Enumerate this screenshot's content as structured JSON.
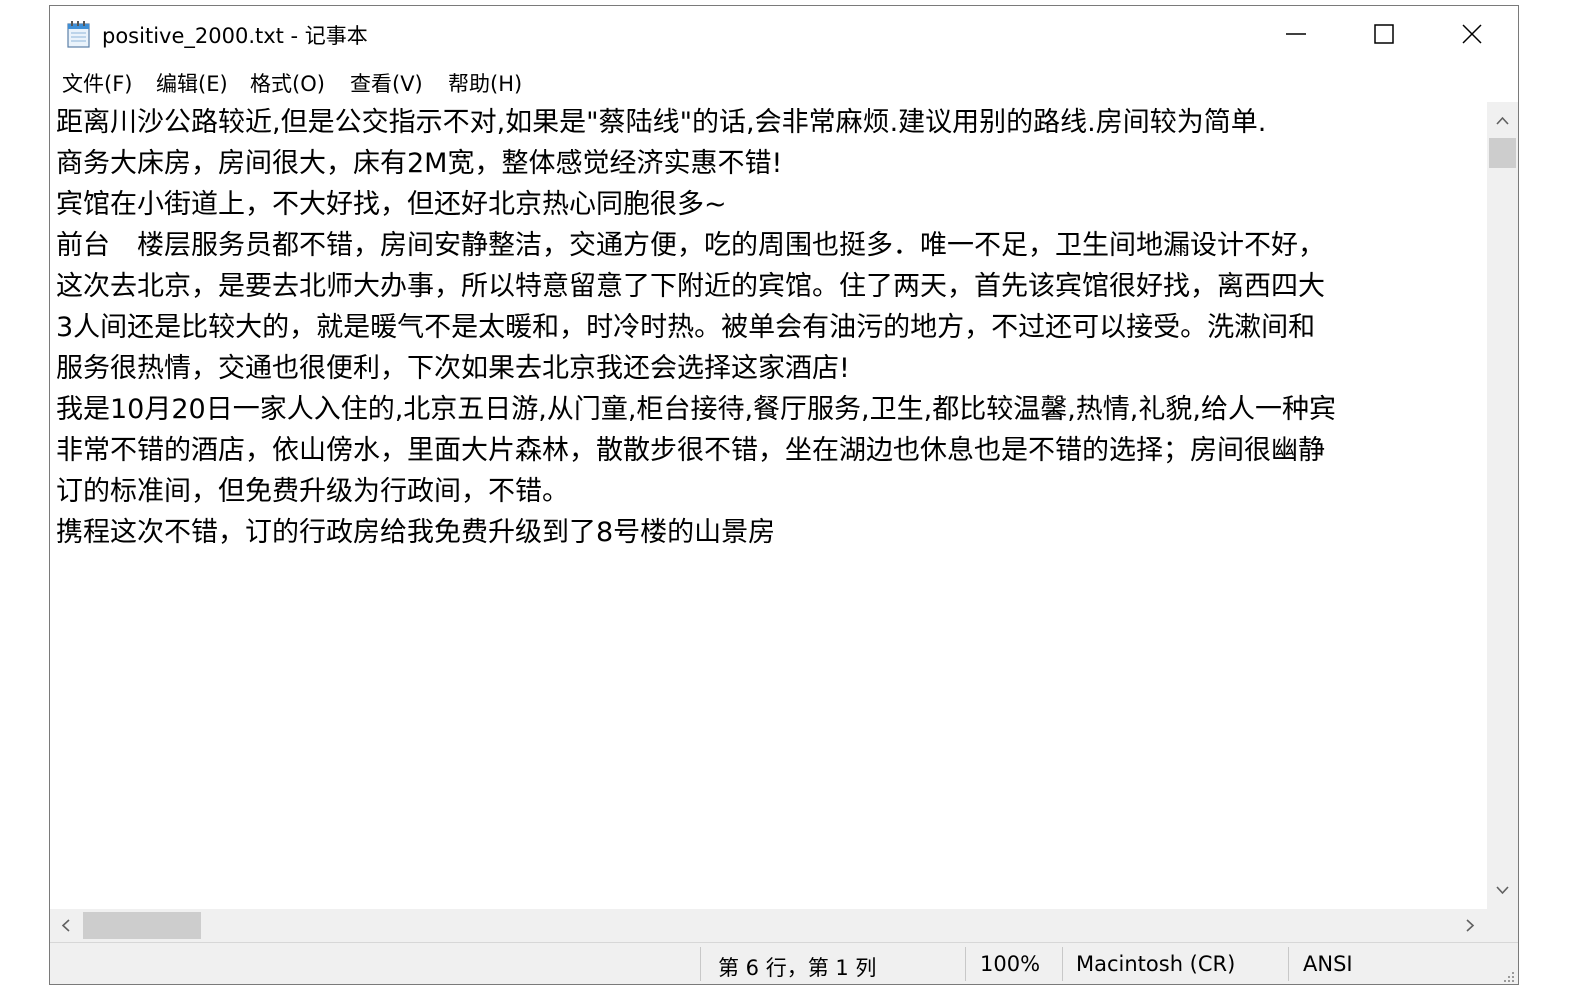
{
  "window": {
    "title": "positive_2000.txt - 记事本"
  },
  "menu": [
    "文件(F)",
    "编辑(E)",
    "格式(O)",
    "查看(V)",
    "帮助(H)"
  ],
  "editor": {
    "lines": [
      "距离川沙公路较近,但是公交指示不对,如果是\"蔡陆线\"的话,会非常麻烦.建议用别的路线.房间较为简单.",
      "",
      "商务大床房，房间很大，床有2M宽，整体感觉经济实惠不错!",
      "",
      "宾馆在小街道上，不大好找，但还好北京热心同胞很多~",
      "",
      "前台　楼层服务员都不错，房间安静整洁，交通方便，吃的周围也挺多．唯一不足，卫生间地漏设计不好，",
      "",
      "这次去北京，是要去北师大办事，所以特意留意了下附近的宾馆。住了两天，首先该宾馆很好找，离西四大",
      "",
      "3人间还是比较大的，就是暖气不是太暖和，时冷时热。被单会有油污的地方，不过还可以接受。洗漱间和",
      "",
      "服务很热情，交通也很便利，下次如果去北京我还会选择这家酒店!",
      "",
      "我是10月20日一家人入住的,北京五日游,从门童,柜台接待,餐厅服务,卫生,都比较温馨,热情,礼貌,给人一种宾",
      "非常不错的酒店，依山傍水，里面大片森林，散散步很不错，坐在湖边也休息也是不错的选择；房间很幽静",
      "",
      "订的标准间，但免费升级为行政间，不错。",
      "",
      "携程这次不错，订的行政房给我免费升级到了8号楼的山景房"
    ]
  },
  "status": {
    "position": "第 6 行，第 1 列",
    "zoom": "100%",
    "line_ending": "Macintosh (CR)",
    "encoding": "ANSI"
  },
  "icons": {
    "app": "notepad-icon",
    "minimize": "minimize-icon",
    "maximize": "maximize-icon",
    "close": "close-icon"
  }
}
